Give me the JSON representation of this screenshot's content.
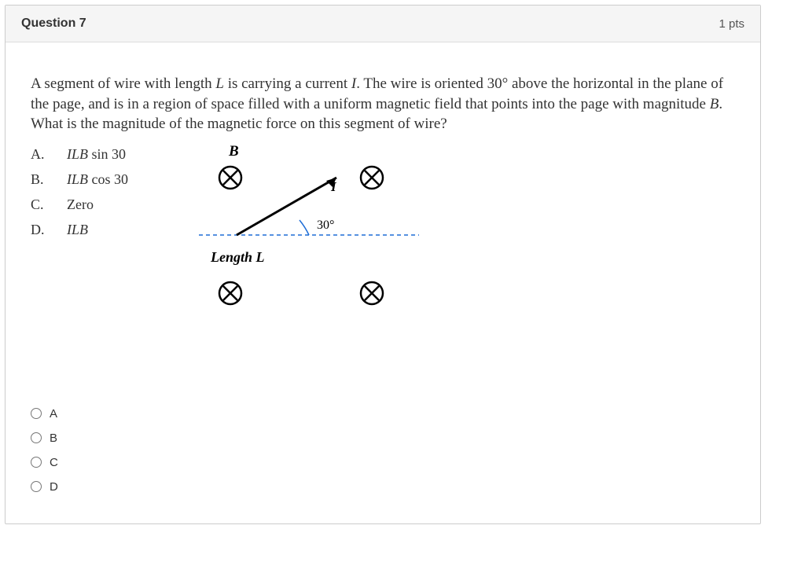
{
  "header": {
    "title": "Question 7",
    "points": "1 pts"
  },
  "prompt": {
    "text_pre": "A segment of wire with length ",
    "L": "L",
    "text_mid1": " is carrying a current ",
    "I": "I",
    "text_mid2": ". The wire is oriented 30° above the horizontal in the plane of the page, and is in a region of space filled with a uniform magnetic field that points into the page with magnitude ",
    "B": "B",
    "text_end": ". What is the magnitude of the magnetic force on this segment of wire?"
  },
  "answers": [
    {
      "letter": "A.",
      "prefix": "ILB",
      "suffix": " sin 30"
    },
    {
      "letter": "B.",
      "prefix": "ILB",
      "suffix": " cos 30"
    },
    {
      "letter": "C.",
      "prefix": "",
      "suffix": "Zero"
    },
    {
      "letter": "D.",
      "prefix": "ILB",
      "suffix": ""
    }
  ],
  "diagram": {
    "B_label": "B",
    "I_label": "I",
    "angle_label": "30°",
    "length_label": "Length L"
  },
  "options": [
    {
      "label": "A"
    },
    {
      "label": "B"
    },
    {
      "label": "C"
    },
    {
      "label": "D"
    }
  ]
}
